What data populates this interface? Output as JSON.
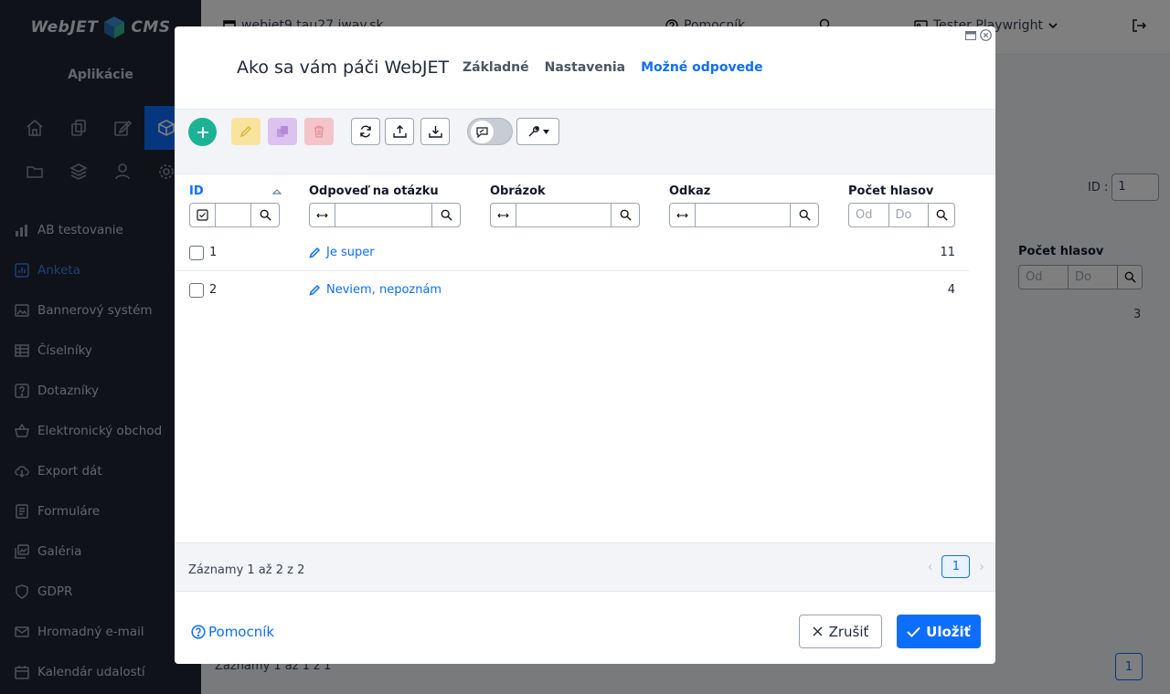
{
  "sidebar": {
    "logo_left": "WebJET",
    "logo_right": "CMS",
    "apps_title": "Aplikácie",
    "icons": [
      "home-icon",
      "copy-icon",
      "edit-icon",
      "box-icon",
      "folder-icon",
      "layers-icon",
      "user-icon",
      "gear-icon"
    ],
    "items": [
      {
        "label": "AB testovanie"
      },
      {
        "label": "Anketa"
      },
      {
        "label": "Bannerový systém"
      },
      {
        "label": "Číselníky"
      },
      {
        "label": "Dotazníky"
      },
      {
        "label": "Elektronický obchod"
      },
      {
        "label": "Export dát"
      },
      {
        "label": "Formuláre"
      },
      {
        "label": "Galéria"
      },
      {
        "label": "GDPR"
      },
      {
        "label": "Hromadný e-mail"
      },
      {
        "label": "Kalendár udalostí"
      }
    ]
  },
  "topbar": {
    "domain": "webjet9.tau27.iway.sk",
    "help": "Pomocník",
    "user": "Tester Playwright"
  },
  "background": {
    "id_label": "ID :",
    "id_value": "1",
    "votes_header": "Počet hlasov",
    "from_placeholder": "Od",
    "to_placeholder": "Do",
    "votes_value": "3",
    "records": "Záznamy 1 až 1 z 1",
    "page": "1"
  },
  "modal": {
    "title": "Ako sa vám páči WebJET",
    "tabs": [
      {
        "label": "Základné"
      },
      {
        "label": "Nastavenia"
      },
      {
        "label": "Možné odpovede"
      }
    ],
    "table": {
      "columns": {
        "id": "ID",
        "answer": "Odpoveď na otázku",
        "image": "Obrázok",
        "link": "Odkaz",
        "votes": "Počet hlasov"
      },
      "from_placeholder": "Od",
      "to_placeholder": "Do",
      "rows": [
        {
          "id": "1",
          "answer": "Je super",
          "votes": "11"
        },
        {
          "id": "2",
          "answer": "Neviem, nepoznám",
          "votes": "4"
        }
      ]
    },
    "records": "Záznamy 1 až 2 z 2",
    "page": "1",
    "help": "Pomocník",
    "cancel": "Zrušiť",
    "save": "Uložiť"
  }
}
